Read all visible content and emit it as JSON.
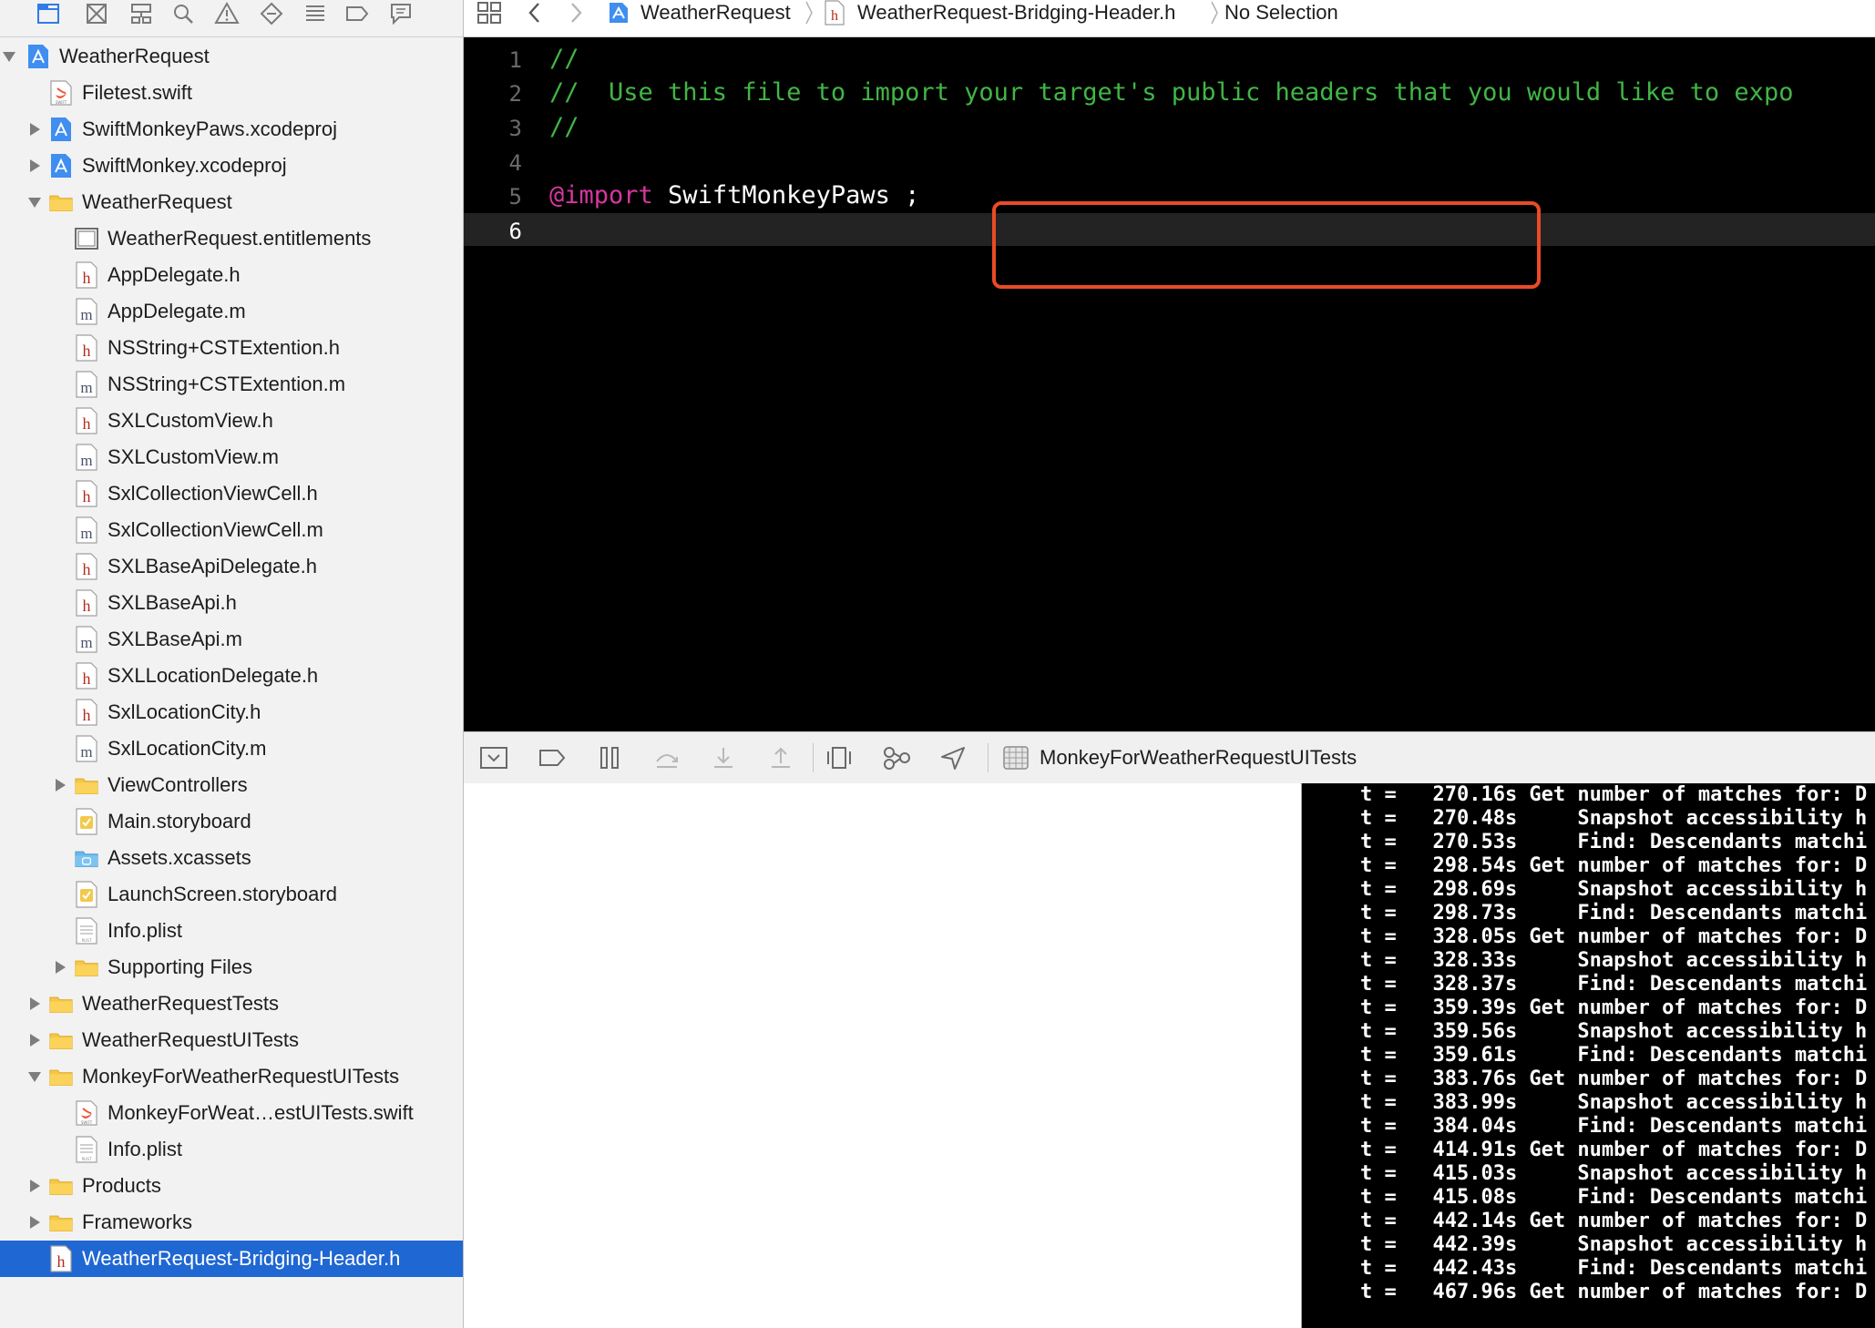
{
  "navigator": {
    "tabs": [
      "project-navigator-icon",
      "source-control-icon",
      "symbol-navigator-icon",
      "find-icon",
      "issue-icon",
      "test-icon",
      "debug-icon",
      "breakpoint-icon",
      "report-icon"
    ],
    "tree": [
      {
        "label": "WeatherRequest",
        "depth": 0,
        "disclosure": "open",
        "icon": "xcodeproj"
      },
      {
        "label": "Filetest.swift",
        "depth": 1,
        "disclosure": "none",
        "icon": "swift"
      },
      {
        "label": "SwiftMonkeyPaws.xcodeproj",
        "depth": 1,
        "disclosure": "closed",
        "icon": "xcodeproj"
      },
      {
        "label": "SwiftMonkey.xcodeproj",
        "depth": 1,
        "disclosure": "closed",
        "icon": "xcodeproj"
      },
      {
        "label": "WeatherRequest",
        "depth": 1,
        "disclosure": "open",
        "icon": "folder"
      },
      {
        "label": "WeatherRequest.entitlements",
        "depth": 2,
        "disclosure": "none",
        "icon": "entitlements"
      },
      {
        "label": "AppDelegate.h",
        "depth": 2,
        "disclosure": "none",
        "icon": "h"
      },
      {
        "label": "AppDelegate.m",
        "depth": 2,
        "disclosure": "none",
        "icon": "m"
      },
      {
        "label": "NSString+CSTExtention.h",
        "depth": 2,
        "disclosure": "none",
        "icon": "h"
      },
      {
        "label": "NSString+CSTExtention.m",
        "depth": 2,
        "disclosure": "none",
        "icon": "m"
      },
      {
        "label": "SXLCustomView.h",
        "depth": 2,
        "disclosure": "none",
        "icon": "h"
      },
      {
        "label": "SXLCustomView.m",
        "depth": 2,
        "disclosure": "none",
        "icon": "m"
      },
      {
        "label": "SxlCollectionViewCell.h",
        "depth": 2,
        "disclosure": "none",
        "icon": "h"
      },
      {
        "label": "SxlCollectionViewCell.m",
        "depth": 2,
        "disclosure": "none",
        "icon": "m"
      },
      {
        "label": "SXLBaseApiDelegate.h",
        "depth": 2,
        "disclosure": "none",
        "icon": "h"
      },
      {
        "label": "SXLBaseApi.h",
        "depth": 2,
        "disclosure": "none",
        "icon": "h"
      },
      {
        "label": "SXLBaseApi.m",
        "depth": 2,
        "disclosure": "none",
        "icon": "m"
      },
      {
        "label": "SXLLocationDelegate.h",
        "depth": 2,
        "disclosure": "none",
        "icon": "h"
      },
      {
        "label": "SxlLocationCity.h",
        "depth": 2,
        "disclosure": "none",
        "icon": "h"
      },
      {
        "label": "SxlLocationCity.m",
        "depth": 2,
        "disclosure": "none",
        "icon": "m"
      },
      {
        "label": "ViewControllers",
        "depth": 2,
        "disclosure": "closed",
        "icon": "folder"
      },
      {
        "label": "Main.storyboard",
        "depth": 2,
        "disclosure": "none",
        "icon": "storyboard"
      },
      {
        "label": "Assets.xcassets",
        "depth": 2,
        "disclosure": "none",
        "icon": "assets"
      },
      {
        "label": "LaunchScreen.storyboard",
        "depth": 2,
        "disclosure": "none",
        "icon": "storyboard"
      },
      {
        "label": "Info.plist",
        "depth": 2,
        "disclosure": "none",
        "icon": "plist"
      },
      {
        "label": "Supporting Files",
        "depth": 2,
        "disclosure": "closed",
        "icon": "folder"
      },
      {
        "label": "WeatherRequestTests",
        "depth": 1,
        "disclosure": "closed",
        "icon": "folder"
      },
      {
        "label": "WeatherRequestUITests",
        "depth": 1,
        "disclosure": "closed",
        "icon": "folder"
      },
      {
        "label": "MonkeyForWeatherRequestUITests",
        "depth": 1,
        "disclosure": "open",
        "icon": "folder"
      },
      {
        "label": "MonkeyForWeat…estUITests.swift",
        "depth": 2,
        "disclosure": "none",
        "icon": "swift"
      },
      {
        "label": "Info.plist",
        "depth": 2,
        "disclosure": "none",
        "icon": "plist"
      },
      {
        "label": "Products",
        "depth": 1,
        "disclosure": "closed",
        "icon": "folder"
      },
      {
        "label": "Frameworks",
        "depth": 1,
        "disclosure": "closed",
        "icon": "folder"
      },
      {
        "label": "WeatherRequest-Bridging-Header.h",
        "depth": 1,
        "disclosure": "none",
        "icon": "h",
        "selected": true
      }
    ]
  },
  "jumpbar": {
    "project": "WeatherRequest",
    "file": "WeatherRequest-Bridging-Header.h",
    "selection": "No Selection"
  },
  "editor": {
    "lines": [
      {
        "num": "1",
        "segments": [
          {
            "text": "//",
            "cls": "comment"
          }
        ]
      },
      {
        "num": "2",
        "segments": [
          {
            "text": "//  Use this file to import your target's public headers that you would like to expo",
            "cls": "comment"
          }
        ]
      },
      {
        "num": "3",
        "segments": [
          {
            "text": "//",
            "cls": "comment"
          }
        ]
      },
      {
        "num": "4",
        "segments": []
      },
      {
        "num": "5",
        "segments": [
          {
            "text": "@import",
            "cls": "kw"
          },
          {
            "text": " SwiftMonkeyPaws ;",
            "cls": ""
          }
        ]
      },
      {
        "num": "6",
        "segments": [],
        "current": true
      }
    ]
  },
  "debugbar": {
    "target_label": "MonkeyForWeatherRequestUITests"
  },
  "console": {
    "lines": [
      "t =   270.16s Get number of matches for: D",
      "t =   270.48s     Snapshot accessibility h",
      "t =   270.53s     Find: Descendants matchi",
      "t =   298.54s Get number of matches for: D",
      "t =   298.69s     Snapshot accessibility h",
      "t =   298.73s     Find: Descendants matchi",
      "t =   328.05s Get number of matches for: D",
      "t =   328.33s     Snapshot accessibility h",
      "t =   328.37s     Find: Descendants matchi",
      "t =   359.39s Get number of matches for: D",
      "t =   359.56s     Snapshot accessibility h",
      "t =   359.61s     Find: Descendants matchi",
      "t =   383.76s Get number of matches for: D",
      "t =   383.99s     Snapshot accessibility h",
      "t =   384.04s     Find: Descendants matchi",
      "t =   414.91s Get number of matches for: D",
      "t =   415.03s     Snapshot accessibility h",
      "t =   415.08s     Find: Descendants matchi",
      "t =   442.14s Get number of matches for: D",
      "t =   442.39s     Snapshot accessibility h",
      "t =   442.43s     Find: Descendants matchi",
      "t =   467.96s Get number of matches for: D"
    ]
  },
  "colors": {
    "accent": "#1f67d2",
    "comment": "#41b645",
    "keyword": "#d6379f",
    "highlight_border": "#ea4b25"
  }
}
